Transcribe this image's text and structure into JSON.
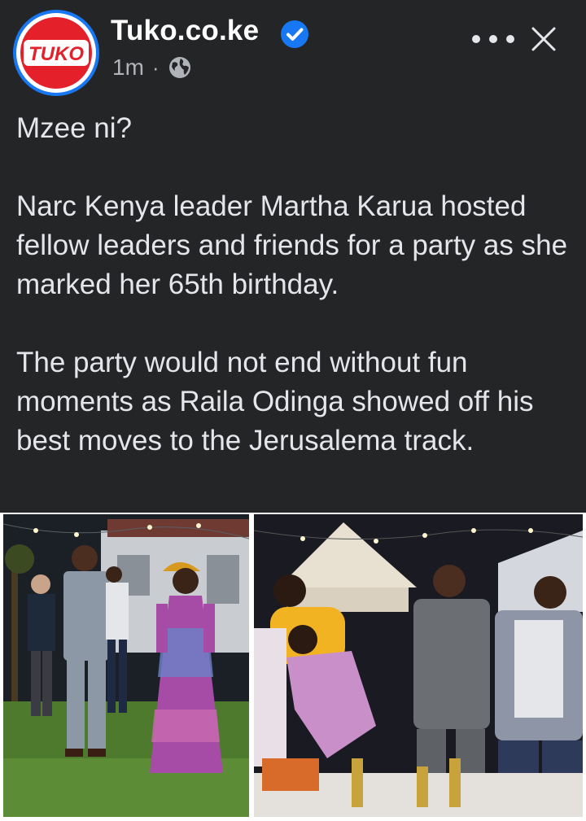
{
  "header": {
    "page_name": "Tuko.co.ke",
    "logo_text": "TUKO",
    "time": "1m",
    "separator": "·",
    "audience_icon": "globe-icon",
    "verified_icon": "verified-badge-icon",
    "more_icon": "more-options-icon",
    "close_icon": "close-icon"
  },
  "post": {
    "paragraphs": [
      "Mzee ni?",
      "Narc Kenya leader Martha Karua hosted fellow leaders and friends for a party as she marked her 65th birthday.",
      "The party would not end without fun moments as Raila Odinga showed off his best moves to the Jerusalema track."
    ]
  },
  "photos": [
    {
      "name": "photo-outdoor-walk"
    },
    {
      "name": "photo-dance-party"
    }
  ],
  "colors": {
    "background": "#242526",
    "text": "#e4e6eb",
    "muted": "#b0b3b8",
    "accent": "#1877f2",
    "brand_red": "#e4202b"
  }
}
